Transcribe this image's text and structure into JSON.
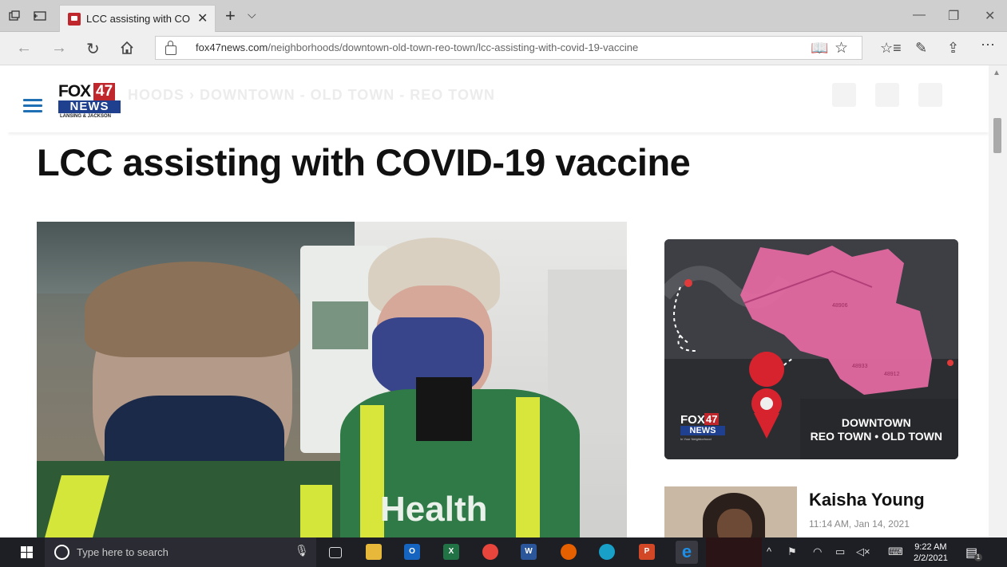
{
  "browser": {
    "tab": {
      "title": "LCC assisting with COVI"
    },
    "url": {
      "domain": "fox47news.com",
      "path": "/neighborhoods/downtown-old-town-reo-town/lcc-assisting-with-covid-19-vaccine"
    }
  },
  "site": {
    "logo": {
      "fox": "FOX",
      "number": "47",
      "news": "NEWS",
      "sub": "LANSING & JACKSON"
    },
    "breadcrumb_faded": "HOODS  ›  DOWNTOWN - OLD TOWN - REO TOWN"
  },
  "article": {
    "headline": "LCC assisting with COVID-19 vaccine"
  },
  "sidebar": {
    "map_card": {
      "caption_line1": "DOWNTOWN",
      "caption_line2": "REO TOWN • OLD TOWN",
      "logo_fox": "FOX",
      "logo_number": "47",
      "logo_news": "NEWS",
      "logo_sub": "In Your Neighborhood",
      "area_labels": [
        "48906",
        "48933",
        "48912"
      ]
    },
    "author": {
      "name": "Kaisha Young",
      "timestamp": "11:14 AM, Jan 14, 2021"
    }
  },
  "taskbar": {
    "search_placeholder": "Type here to search",
    "clock": {
      "time": "9:22 AM",
      "date": "2/2/2021"
    },
    "notification_count": "1"
  },
  "colors": {
    "brand_red": "#c0272d",
    "brand_blue": "#1f3f8f",
    "link_blue": "#1f6fb5",
    "map_pink": "#e66aa3"
  }
}
